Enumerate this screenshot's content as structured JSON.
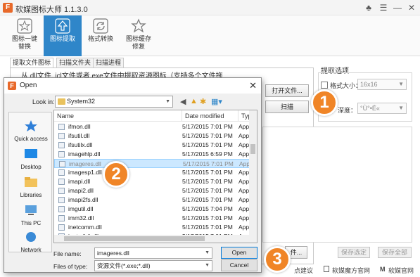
{
  "app": {
    "title": "软媒图标大师 1.1.3.0"
  },
  "toolbar": {
    "tools": [
      {
        "label_l1": "图标一键",
        "label_l2": "替换"
      },
      {
        "label_l1": "图标提取",
        "label_l2": ""
      },
      {
        "label_l1": "格式转换",
        "label_l2": ""
      },
      {
        "label_l1": "图标缓存",
        "label_l2": "修复"
      }
    ]
  },
  "tabs": [
    "提取文件图标",
    "扫描文件夹",
    "扫描进程"
  ],
  "main": {
    "hint": "从.dll文件,.icl文件或者.exe文件中提取资源图标（支持多个文件拖",
    "open_file_button": "打开文件...",
    "scan_button": "扫描",
    "save_all_partial": "件..."
  },
  "options": {
    "title": "提取选项",
    "format_size_label": "格式大小：",
    "format_size_value": "16x16",
    "depth_label": "深度：",
    "depth_value": "°Ù°•É«",
    "save_selected": "保存选定",
    "save_all": "保存全部"
  },
  "footer": {
    "suggest": "点建议",
    "cube_site": "软媒魔方官网",
    "ruanmei_site": "软媒官网"
  },
  "dialog": {
    "title": "Open",
    "look_in_label": "Look in:",
    "look_in_value": "System32",
    "places": [
      "Quick access",
      "Desktop",
      "Libraries",
      "This PC",
      "Network"
    ],
    "columns": [
      "Name",
      "Date modified",
      "Type"
    ],
    "files": [
      {
        "name": "ifmon.dll",
        "date": "5/17/2015 7:01 PM",
        "type": "Applic"
      },
      {
        "name": "ifsutil.dll",
        "date": "5/17/2015 7:01 PM",
        "type": "Applic"
      },
      {
        "name": "ifsutilx.dll",
        "date": "5/17/2015 7:01 PM",
        "type": "Applic"
      },
      {
        "name": "imagehlp.dll",
        "date": "5/17/2015 6:59 PM",
        "type": "Applic"
      },
      {
        "name": "imageres.dll",
        "date": "5/17/2015 7:01 PM",
        "type": "Applic"
      },
      {
        "name": "imagesp1.dll",
        "date": "5/17/2015 7:01 PM",
        "type": "Applic"
      },
      {
        "name": "imapi.dll",
        "date": "5/17/2015 7:01 PM",
        "type": "Applic"
      },
      {
        "name": "imapi2.dll",
        "date": "5/17/2015 7:01 PM",
        "type": "Applic"
      },
      {
        "name": "imapi2fs.dll",
        "date": "5/17/2015 7:01 PM",
        "type": "Applic"
      },
      {
        "name": "imgutil.dll",
        "date": "5/17/2015 7:04 PM",
        "type": "Applic"
      },
      {
        "name": "imm32.dll",
        "date": "5/17/2015 7:01 PM",
        "type": "Applic"
      },
      {
        "name": "inetcomm.dll",
        "date": "5/17/2015 7:01 PM",
        "type": "Applic"
      },
      {
        "name": "inetmib1.dll",
        "date": "5/17/2015 7:01 PM",
        "type": "Applic"
      }
    ],
    "file_name_label": "File name:",
    "file_name_value": "imageres.dll",
    "files_of_type_label": "Files of type:",
    "files_of_type_value": "资源文件(*.exe;*.dll)",
    "open_button": "Open",
    "cancel_button": "Cancel"
  },
  "callouts": [
    "1",
    "2",
    "3"
  ],
  "colors": {
    "accent": "#2f86c9",
    "callout": "#f08527",
    "selection": "#cce8ff"
  }
}
